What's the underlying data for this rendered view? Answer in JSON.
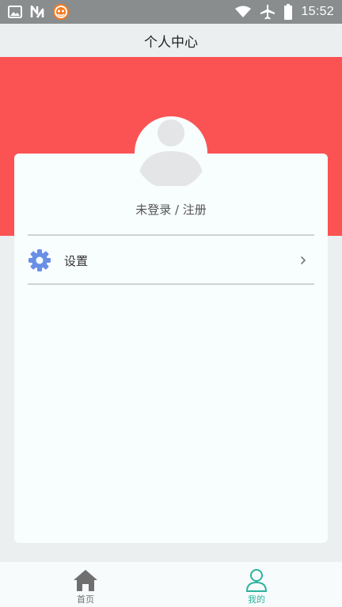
{
  "status_bar": {
    "time": "15:52",
    "icons_left": [
      "image-icon",
      "n-notification-icon",
      "app-logo-icon"
    ],
    "icons_right": [
      "wifi-icon",
      "airplane-icon",
      "battery-icon"
    ]
  },
  "header": {
    "title": "个人中心"
  },
  "profile": {
    "login_text": "未登录 / 注册",
    "avatar": "avatar-placeholder-icon"
  },
  "menu": {
    "items": [
      {
        "label": "设置",
        "icon": "gear-icon",
        "trailing": "chevron-right-icon"
      }
    ]
  },
  "bottom_nav": {
    "items": [
      {
        "label": "首页",
        "icon": "home-icon",
        "active": false
      },
      {
        "label": "我的",
        "icon": "user-icon",
        "active": true
      }
    ]
  },
  "colors": {
    "header_band": "#fb5354",
    "active_tab": "#2bb39d",
    "settings_icon": "#6a8fe6",
    "status_bar": "#8a8d8e"
  }
}
